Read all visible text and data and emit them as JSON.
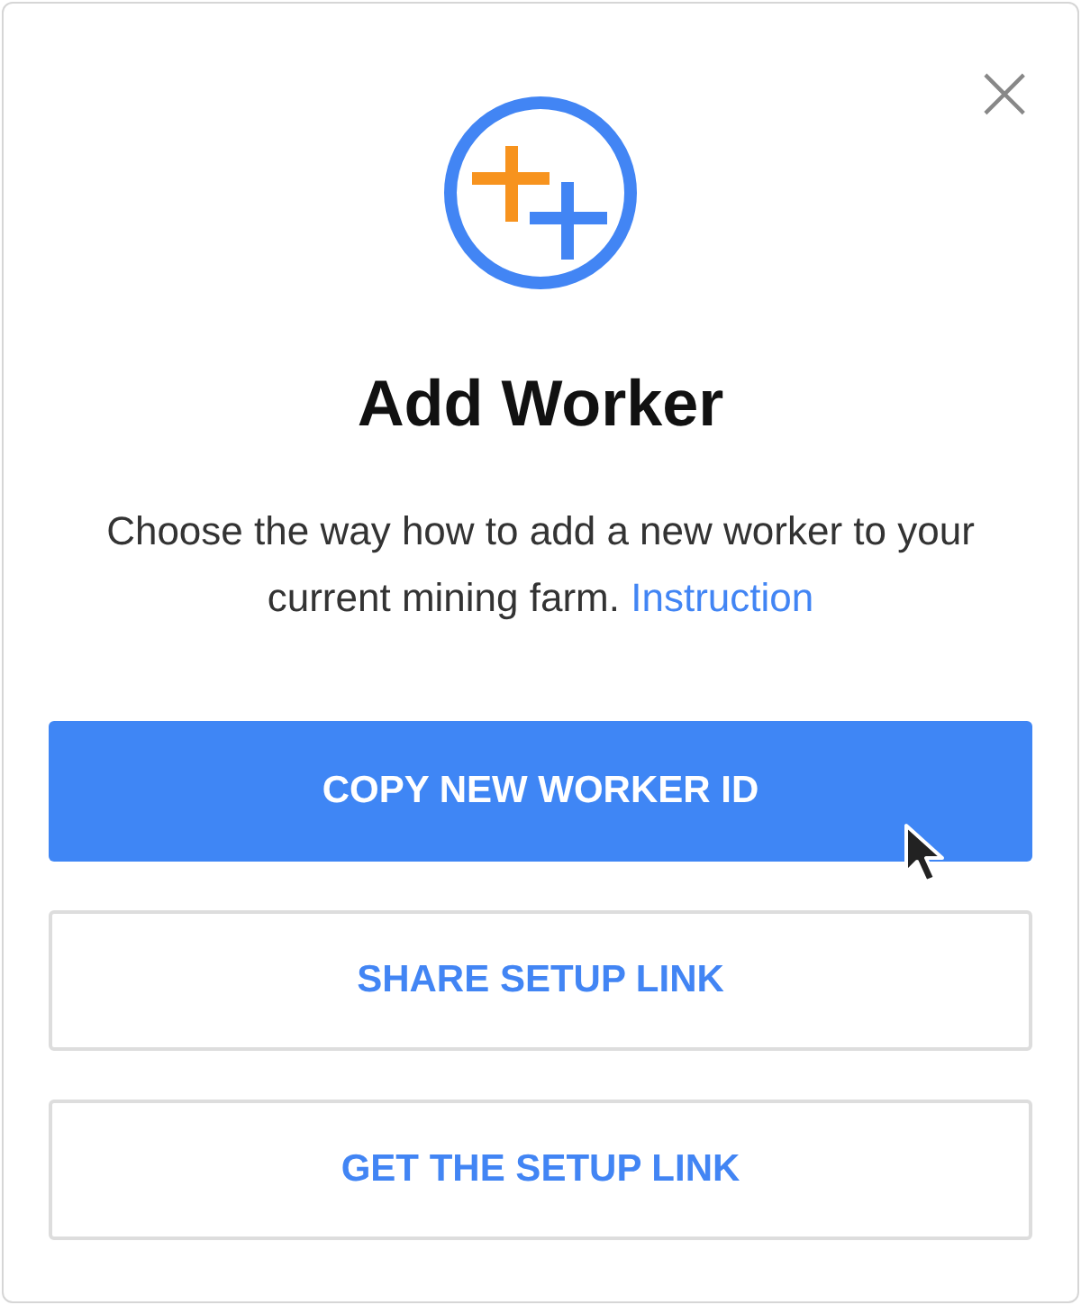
{
  "dialog": {
    "title": "Add Worker",
    "close": "×",
    "description": "Choose the way how to add a new worker to your current mining farm.",
    "link": "Instruction",
    "buttons": [
      {
        "label": "COPY NEW WORKER ID",
        "kind": "primary",
        "hovered": true
      },
      {
        "label": "SHARE SETUP LINK",
        "kind": "secondary",
        "hovered": false
      },
      {
        "label": "GET THE SETUP LINK",
        "kind": "secondary",
        "hovered": false
      }
    ]
  }
}
